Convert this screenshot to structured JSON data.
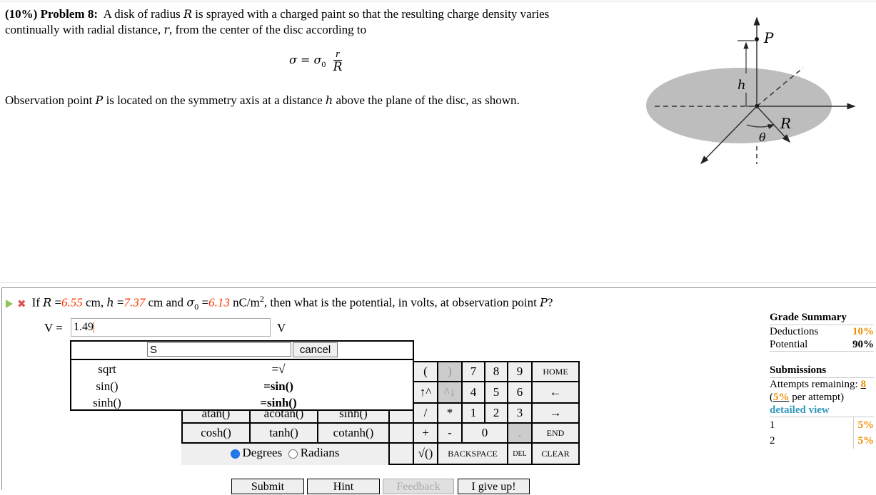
{
  "problem": {
    "weight": "(10%)",
    "label": "Problem 8:",
    "text_1": "A disk of radius",
    "var_R": "R",
    "text_2": "is sprayed with a charged paint so that the resulting charge density varies",
    "text_3": "continually with radial distance,",
    "var_r": "r",
    "text_4": ", from the center of the disc according to",
    "equation": {
      "lhs": "σ = σ",
      "sub": "0",
      "numerator": "r",
      "denominator": "R"
    },
    "obs_1": "Observation point",
    "var_P": "P",
    "obs_2": "is located on the symmetry axis at a distance",
    "var_h": "h",
    "obs_3": "above the plane of the disc, as shown."
  },
  "figure": {
    "labels": {
      "P": "P",
      "h": "h",
      "R": "R",
      "theta": "θ"
    },
    "disk_color": "#bdbdbd"
  },
  "question": {
    "status_icons": [
      "play-icon",
      "incorrect-x-icon"
    ],
    "t1": "If",
    "R_var": "R",
    "eq": "=",
    "R_val": "6.55",
    "unit_cm": "cm,",
    "h_var": "h",
    "h_val": "7.37",
    "t_and": "cm and",
    "sigma": "σ",
    "sigma_sub": "0",
    "sigma_val": "6.13",
    "sigma_unit": "nC/m",
    "sigma_exp": "2",
    "t_end": ", then what is the potential, in volts, at observation point",
    "P_var": "P",
    "qmark": "?"
  },
  "answer": {
    "label": "V =",
    "value": "1.49",
    "unit": "V"
  },
  "autocomplete": {
    "search_value": "S",
    "cancel_label": "cancel",
    "rows": [
      {
        "name": "sqrt",
        "insert": "=√"
      },
      {
        "name": "sin()",
        "insert": "=sin()"
      },
      {
        "name": "sinh()",
        "insert": "=sinh()"
      }
    ]
  },
  "functions": {
    "row_hidden": [
      "atan()",
      "acotan()",
      "sinh()"
    ],
    "row_visible": [
      "cosh()",
      "tanh()",
      "cotanh()"
    ],
    "angle_mode": {
      "options": [
        "Degrees",
        "Radians"
      ],
      "selected": "Degrees"
    }
  },
  "keypad": {
    "keys": {
      "lparen": "(",
      "rparen": ")",
      "k7": "7",
      "k8": "8",
      "k9": "9",
      "home": "HOME",
      "up": "↑^",
      "down": "^↓",
      "k4": "4",
      "k5": "5",
      "k6": "6",
      "left": "←",
      "div": "/",
      "mul": "*",
      "k1": "1",
      "k2": "2",
      "k3": "3",
      "right": "→",
      "plus": "+",
      "minus": "-",
      "k0": "0",
      "dot": ".",
      "end": "END",
      "sqrt": "√()",
      "backspace": "BACKSPACE",
      "del": "DEL",
      "clear": "CLEAR"
    }
  },
  "actions": {
    "submit": "Submit",
    "hint": "Hint",
    "feedback": "Feedback",
    "give_up": "I give up!"
  },
  "grade_summary": {
    "title": "Grade Summary",
    "deductions_label": "Deductions",
    "deductions_value": "10%",
    "potential_label": "Potential",
    "potential_value": "90%"
  },
  "submissions": {
    "title": "Submissions",
    "attempts_label": "Attempts remaining:",
    "attempts_value": "8",
    "per_attempt_open": "(",
    "per_attempt_value": "5%",
    "per_attempt_text": "per attempt)",
    "detailed_view": "detailed view",
    "rows": [
      {
        "n": "1",
        "deduction": "5%"
      },
      {
        "n": "2",
        "deduction": "5%"
      }
    ]
  },
  "colors": {
    "given_values": "#ff3300",
    "orange": "#f08c00",
    "link": "#3399bb",
    "radio_selected": "#1a73e8"
  }
}
